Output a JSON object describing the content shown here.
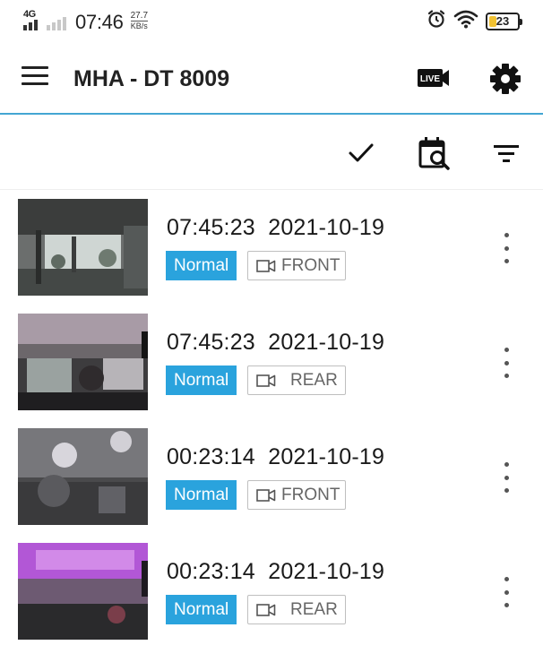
{
  "status_bar": {
    "network_label": "4G",
    "time": "07:46",
    "speed_value": "27.7",
    "speed_unit": "KB/s",
    "battery_percent": "23",
    "battery_level": 0.23,
    "icons": [
      "signal-icon",
      "alarm-icon",
      "wifi-icon",
      "battery-icon"
    ]
  },
  "app_bar": {
    "title": "MHA - DT 8009",
    "live_label": "LIVE",
    "icons": [
      "menu-icon",
      "live-camera-icon",
      "gear-icon"
    ]
  },
  "toolbar": {
    "icons": [
      "check-icon",
      "calendar-search-icon",
      "filter-icon"
    ]
  },
  "recordings": [
    {
      "time": "07:45:23",
      "date": "2021-10-19",
      "status": "Normal",
      "camera": "FRONT"
    },
    {
      "time": "07:45:23",
      "date": "2021-10-19",
      "status": "Normal",
      "camera": "REAR"
    },
    {
      "time": "00:23:14",
      "date": "2021-10-19",
      "status": "Normal",
      "camera": "FRONT"
    },
    {
      "time": "00:23:14",
      "date": "2021-10-19",
      "status": "Normal",
      "camera": "REAR"
    }
  ],
  "colors": {
    "accent": "#2aa3dd",
    "divider": "#43a6d3",
    "battery_fill": "#f1c232"
  }
}
